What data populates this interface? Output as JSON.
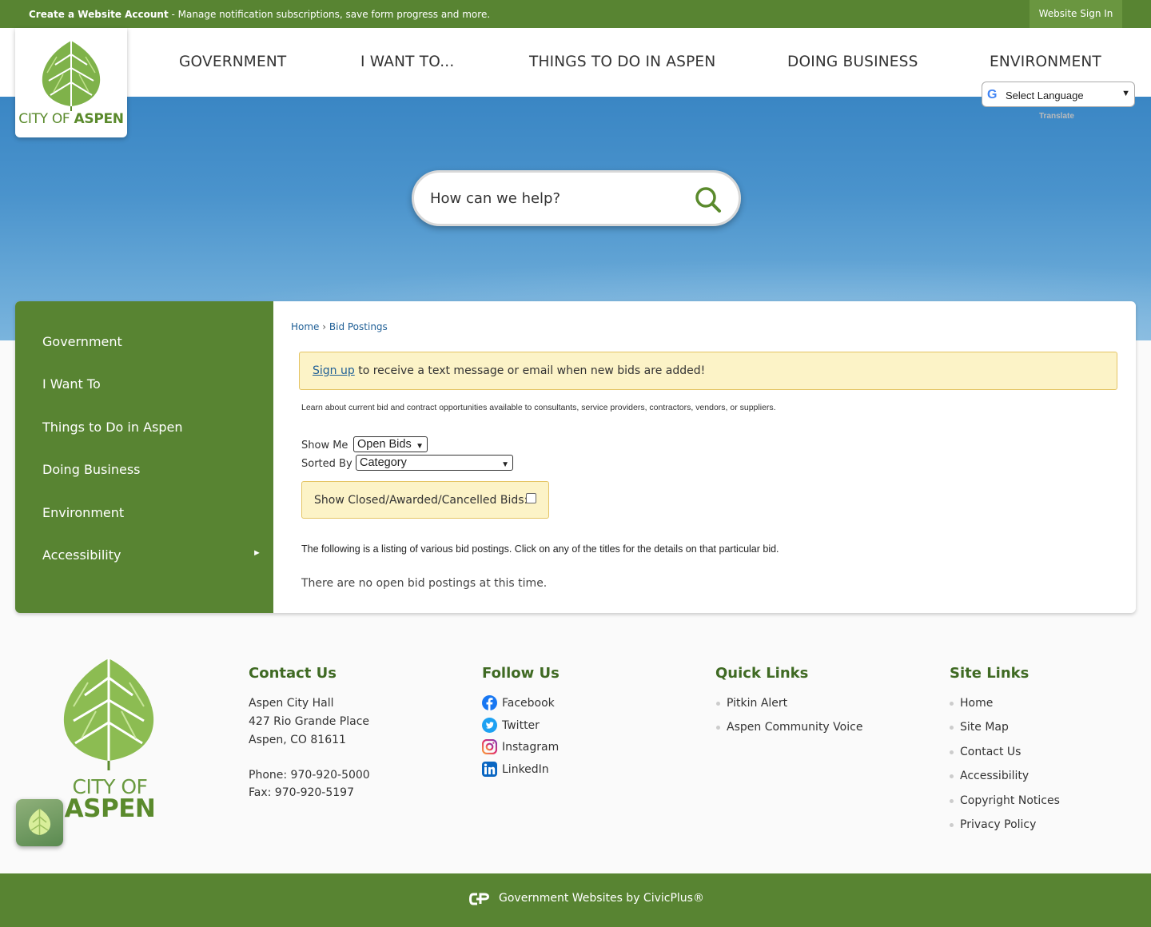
{
  "topbar": {
    "account_bold": "Create a Website Account",
    "account_rest": " - Manage notification subscriptions, save form progress and more.",
    "signin_label": "Website Sign In"
  },
  "logo": {
    "city": "CITY OF ",
    "name": "ASPEN"
  },
  "nav": {
    "items": [
      "GOVERNMENT",
      "I WANT TO...",
      "THINGS TO DO IN ASPEN",
      "DOING BUSINESS",
      "ENVIRONMENT"
    ]
  },
  "language": {
    "label": "Select Language",
    "translate": "Translate"
  },
  "search": {
    "placeholder": "How can we help?"
  },
  "sidenav": {
    "items": [
      "Government",
      "I Want To",
      "Things to Do in Aspen",
      "Doing Business",
      "Environment",
      "Accessibility"
    ]
  },
  "breadcrumb": {
    "home": "Home",
    "sep": " › ",
    "current": "Bid Postings"
  },
  "alert": {
    "link": "Sign up",
    "text": " to receive a text message or email when new bids are added!"
  },
  "intro": "Learn about current bid and contract opportunities available to consultants, service providers, contractors, vendors, or suppliers.",
  "filters": {
    "show_me_label": "Show Me",
    "show_me_value": "Open Bids",
    "sorted_by_label": "Sorted By",
    "sorted_by_value": "Category",
    "closed_label": "Show Closed/Awarded/Cancelled Bids:"
  },
  "listing_text": "The following is a listing of various bid postings. Click on any of the titles for the details on that particular bid.",
  "empty_text": "There are no open bid postings at this time.",
  "footer": {
    "logo_line1": "CITY OF",
    "logo_line2": "ASPEN",
    "contact": {
      "title": "Contact Us",
      "line1": "Aspen City Hall",
      "line2": "427 Rio Grande Place",
      "line3": "Aspen, CO 81611",
      "phone": "Phone: 970-920-5000",
      "fax": "Fax: 970-920-5197"
    },
    "follow": {
      "title": "Follow Us",
      "items": [
        "Facebook",
        "Twitter",
        "Instagram",
        "LinkedIn"
      ]
    },
    "quick": {
      "title": "Quick Links",
      "items": [
        "Pitkin Alert",
        "Aspen Community Voice"
      ]
    },
    "site": {
      "title": "Site Links",
      "items": [
        "Home",
        "Site Map",
        "Contact Us",
        "Accessibility",
        "Copyright Notices",
        "Privacy Policy"
      ]
    }
  },
  "bottombar": {
    "text": "Government Websites by CivicPlus®"
  },
  "colors": {
    "green": "#588432",
    "link_blue": "#1f5f96",
    "alert_bg": "#fcf3c7"
  }
}
